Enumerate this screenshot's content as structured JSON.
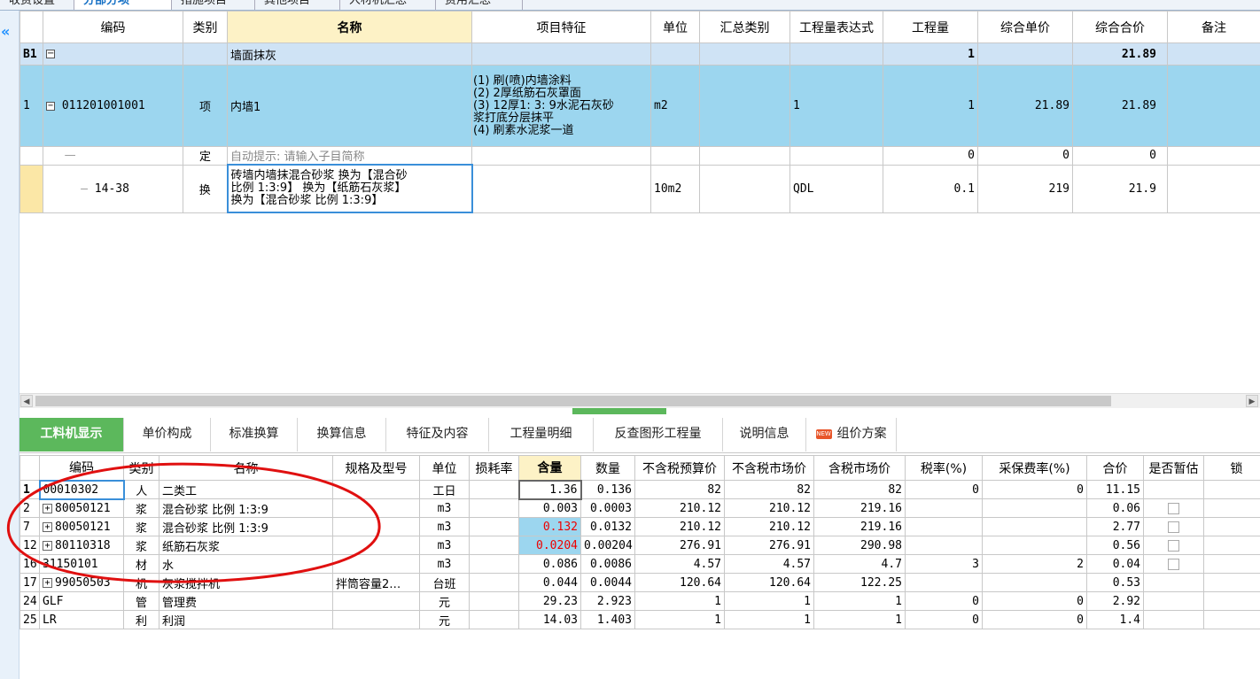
{
  "top_tabs": [
    "收费设置",
    "分部分项",
    "措施项目",
    "其他项目",
    "人材机汇总",
    "费用汇总"
  ],
  "upper": {
    "headers": [
      "编码",
      "类别",
      "名称",
      "项目特征",
      "单位",
      "汇总类别",
      "工程量表达式",
      "工程量",
      "综合单价",
      "综合合价",
      "备注"
    ],
    "section": {
      "id": "B1",
      "name": "墙面抹灰",
      "qty": "1",
      "total": "21.89"
    },
    "item": {
      "no": "1",
      "code": "011201001001",
      "type": "项",
      "name": "内墙1",
      "feature_lines": [
        "(1) 刷(喷)内墙涂料",
        "(2) 2厚纸筋石灰罩面",
        "(3) 12厚1: 3: 9水泥石灰砂",
        "浆打底分层抹平",
        "(4) 刷素水泥浆一道"
      ],
      "unit": "m2",
      "expr": "1",
      "qty": "1",
      "unit_price": "21.89",
      "total": "21.89"
    },
    "auto_row": {
      "type": "定",
      "hint": "自动提示: 请输入子目简称",
      "qty": "0",
      "unit_price": "0",
      "total": "0"
    },
    "sub_row": {
      "code": "14-38",
      "type": "换",
      "name_lines": [
        "砖墙内墙抹混合砂浆  换为【混合砂",
        "比例 1:3:9】  换为【纸筋石灰浆】",
        "换为【混合砂浆 比例 1:3:9】"
      ],
      "unit": "10m2",
      "expr": "QDL",
      "qty": "0.1",
      "unit_price": "219",
      "total": "21.9"
    }
  },
  "lower_tabs": [
    "工料机显示",
    "单价构成",
    "标准换算",
    "换算信息",
    "特征及内容",
    "工程量明细",
    "反查图形工程量",
    "说明信息",
    "组价方案"
  ],
  "lower": {
    "headers": [
      "编码",
      "类别",
      "名称",
      "规格及型号",
      "单位",
      "损耗率",
      "含量",
      "数量",
      "不含税预算价",
      "不含税市场价",
      "含税市场价",
      "税率(%)",
      "采保费率(%)",
      "合价",
      "是否暂估",
      "锁"
    ],
    "rows": [
      {
        "no": "1",
        "code": "00010302",
        "type": "人",
        "name": "二类工",
        "spec": "",
        "unit": "工日",
        "content": "1.36",
        "qty": "0.136",
        "pre": "82",
        "mkt": "82",
        "tax_mkt": "82",
        "rate": "0",
        "fee": "0",
        "total": "11.15",
        "chk": false
      },
      {
        "no": "2",
        "code": "80050121",
        "type": "浆",
        "name": "混合砂浆 比例 1:3:9",
        "spec": "",
        "unit": "m3",
        "content": "0.003",
        "qty": "0.0003",
        "pre": "210.12",
        "mkt": "210.12",
        "tax_mkt": "219.16",
        "rate": "",
        "fee": "",
        "total": "0.06",
        "chk": true,
        "plus": true
      },
      {
        "no": "7",
        "code": "80050121",
        "type": "浆",
        "name": "混合砂浆 比例 1:3:9",
        "spec": "",
        "unit": "m3",
        "content": "0.132",
        "qty": "0.0132",
        "pre": "210.12",
        "mkt": "210.12",
        "tax_mkt": "219.16",
        "rate": "",
        "fee": "",
        "total": "2.77",
        "chk": true,
        "plus": true,
        "hl": true
      },
      {
        "no": "12",
        "code": "80110318",
        "type": "浆",
        "name": "纸筋石灰浆",
        "spec": "",
        "unit": "m3",
        "content": "0.0204",
        "qty": "0.00204",
        "pre": "276.91",
        "mkt": "276.91",
        "tax_mkt": "290.98",
        "rate": "",
        "fee": "",
        "total": "0.56",
        "chk": true,
        "plus": true,
        "hl": true
      },
      {
        "no": "16",
        "code": "31150101",
        "type": "材",
        "name": "水",
        "spec": "",
        "unit": "m3",
        "content": "0.086",
        "qty": "0.0086",
        "pre": "4.57",
        "mkt": "4.57",
        "tax_mkt": "4.7",
        "rate": "3",
        "fee": "2",
        "total": "0.04",
        "chk": true
      },
      {
        "no": "17",
        "code": "99050503",
        "type": "机",
        "name": "灰浆搅拌机",
        "spec": "拌筒容量2…",
        "unit": "台班",
        "content": "0.044",
        "qty": "0.0044",
        "pre": "120.64",
        "mkt": "120.64",
        "tax_mkt": "122.25",
        "rate": "",
        "fee": "",
        "total": "0.53",
        "chk": false,
        "plus": true
      },
      {
        "no": "24",
        "code": "GLF",
        "type": "管",
        "name": "管理费",
        "spec": "",
        "unit": "元",
        "content": "29.23",
        "qty": "2.923",
        "pre": "1",
        "mkt": "1",
        "tax_mkt": "1",
        "rate": "0",
        "fee": "0",
        "total": "2.92",
        "chk": false
      },
      {
        "no": "25",
        "code": "LR",
        "type": "利",
        "name": "利润",
        "spec": "",
        "unit": "元",
        "content": "14.03",
        "qty": "1.403",
        "pre": "1",
        "mkt": "1",
        "tax_mkt": "1",
        "rate": "0",
        "fee": "0",
        "total": "1.4",
        "chk": false
      }
    ]
  },
  "colors": {
    "selected_row": "#9cd6ef",
    "active_tab": "#5cb85c",
    "annotation": "#e01010",
    "header_highlight": "#fdf2c6"
  }
}
